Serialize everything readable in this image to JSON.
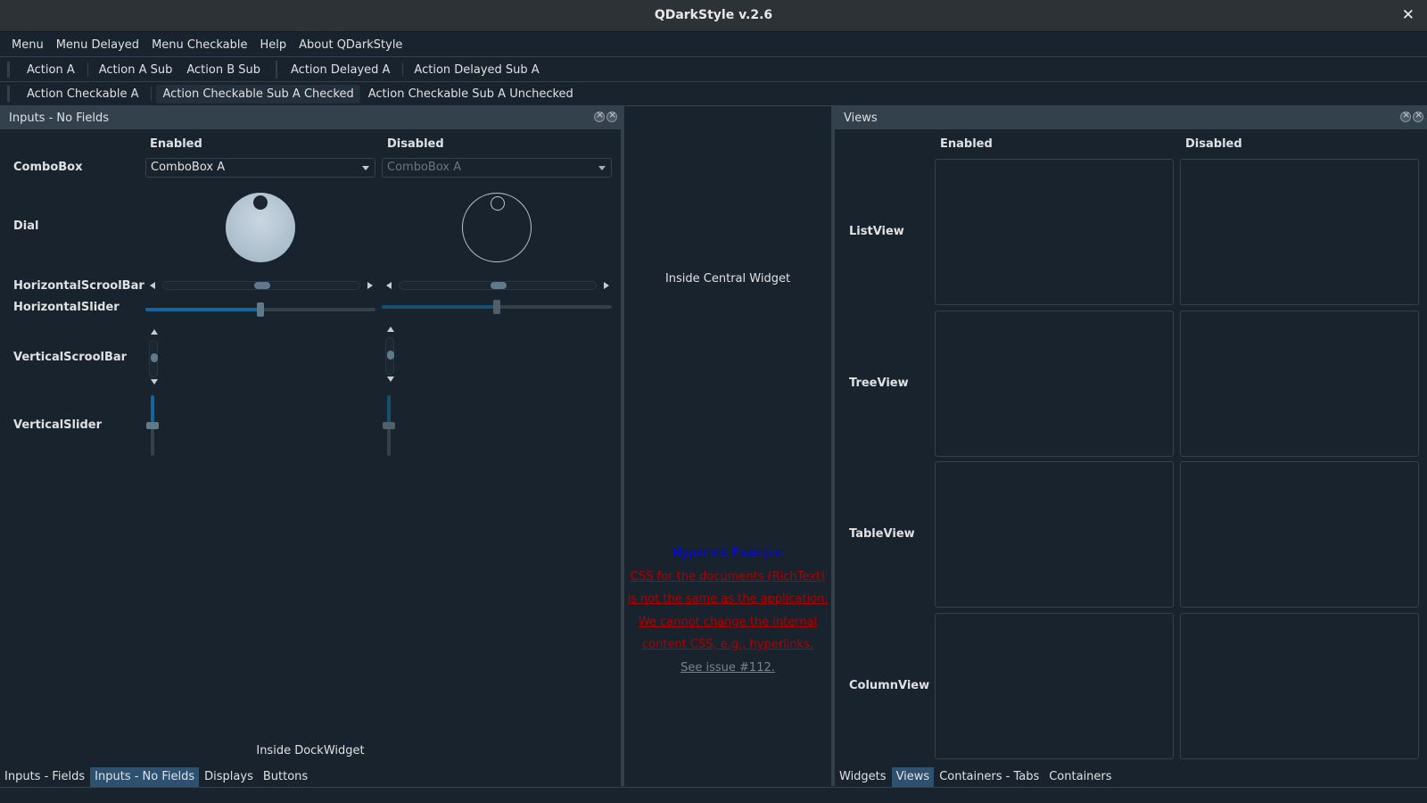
{
  "window": {
    "title": "QDarkStyle v.2.6",
    "close_glyph": "✕"
  },
  "menubar": [
    "Menu",
    "Menu Delayed",
    "Menu Checkable",
    "Help",
    "About QDarkStyle"
  ],
  "toolbar1": {
    "group1": [
      "Action A",
      "Action A Sub",
      "Action B Sub"
    ],
    "group2": [
      "Action Delayed A",
      "Action Delayed Sub A"
    ]
  },
  "toolbar2": {
    "items": [
      "Action Checkable A",
      "Action Checkable Sub A Checked",
      "Action Checkable Sub A Unchecked"
    ]
  },
  "left_dock": {
    "title": "Inputs - No Fields",
    "col_enabled": "Enabled",
    "col_disabled": "Disabled",
    "rows": {
      "combobox": "ComboBox",
      "dial": "Dial",
      "hscroll": "HorizontalScroolBar",
      "hslider": "HorizontalSlider",
      "vscroll": "VerticalScroolBar",
      "vslider": "VerticalSlider"
    },
    "combo_enabled_value": "ComboBox A",
    "combo_disabled_value": "ComboBox A",
    "hslider_enabled_fraction": 0.5,
    "hslider_disabled_fraction": 0.5,
    "footer": "Inside DockWidget",
    "tabs": [
      "Inputs - Fields",
      "Inputs - No Fields",
      "Displays",
      "Buttons"
    ],
    "active_tab": "Inputs - No Fields"
  },
  "central": {
    "label": "Inside Central Widget",
    "hyperlink": "Hyperlink Example",
    "red_lines": [
      "CSS for the documents (RichText)",
      "is not the same as the application.",
      "We cannot change the internal",
      "content CSS, e.g., hyperlinks."
    ],
    "issue": "See issue #112."
  },
  "right_dock": {
    "title": "Views",
    "col_enabled": "Enabled",
    "col_disabled": "Disabled",
    "rows": [
      "ListView",
      "TreeView",
      "TableView",
      "ColumnView"
    ],
    "tabs": [
      "Widgets",
      "Views",
      "Containers - Tabs",
      "Containers"
    ],
    "active_tab": "Views"
  },
  "colors": {
    "background": "#19232D",
    "border": "#32414B",
    "accent": "#1464A0",
    "active_tab": "#2e5170"
  }
}
